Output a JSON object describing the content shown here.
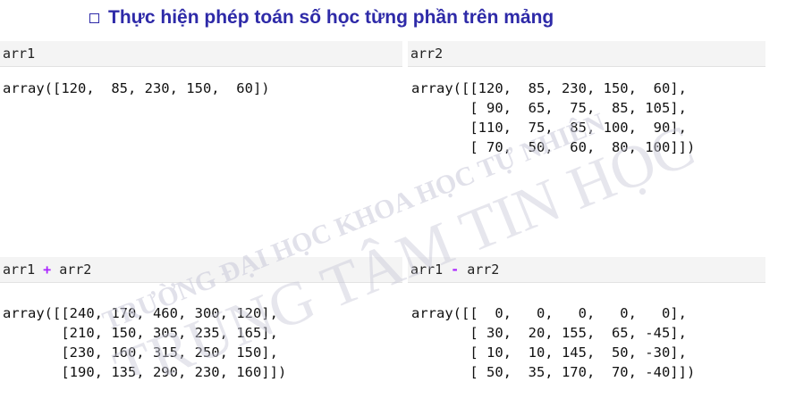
{
  "title": "Thực hiện phép toán số học từng phần trên mảng",
  "cells": [
    {
      "input_left": "arr1",
      "output": "array([120,  85, 230, 150,  60])"
    },
    {
      "input_left": "arr2",
      "output": "array([[120,  85, 230, 150,  60],\n       [ 90,  65,  75,  85, 105],\n       [110,  75,  85, 100,  90],\n       [ 70,  50,  60,  80, 100]])"
    },
    {
      "input_left": "arr1",
      "operator": "+",
      "input_right": "arr2",
      "output": "array([[240, 170, 460, 300, 120],\n       [210, 150, 305, 235, 165],\n       [230, 160, 315, 250, 150],\n       [190, 135, 290, 230, 160]])"
    },
    {
      "input_left": "arr1",
      "operator": "-",
      "input_right": "arr2",
      "output": "array([[  0,   0,   0,   0,   0],\n       [ 30,  20, 155,  65, -45],\n       [ 10,  10, 145,  50, -30],\n       [ 50,  35, 170,  70, -40]])"
    }
  ],
  "watermark": {
    "line1": "TRƯỜNG ĐẠI HỌC KHOA HỌC TỰ NHIÊN",
    "line2": "TRUNG TÂM TIN HỌC",
    "color": "#c8c8d8"
  }
}
